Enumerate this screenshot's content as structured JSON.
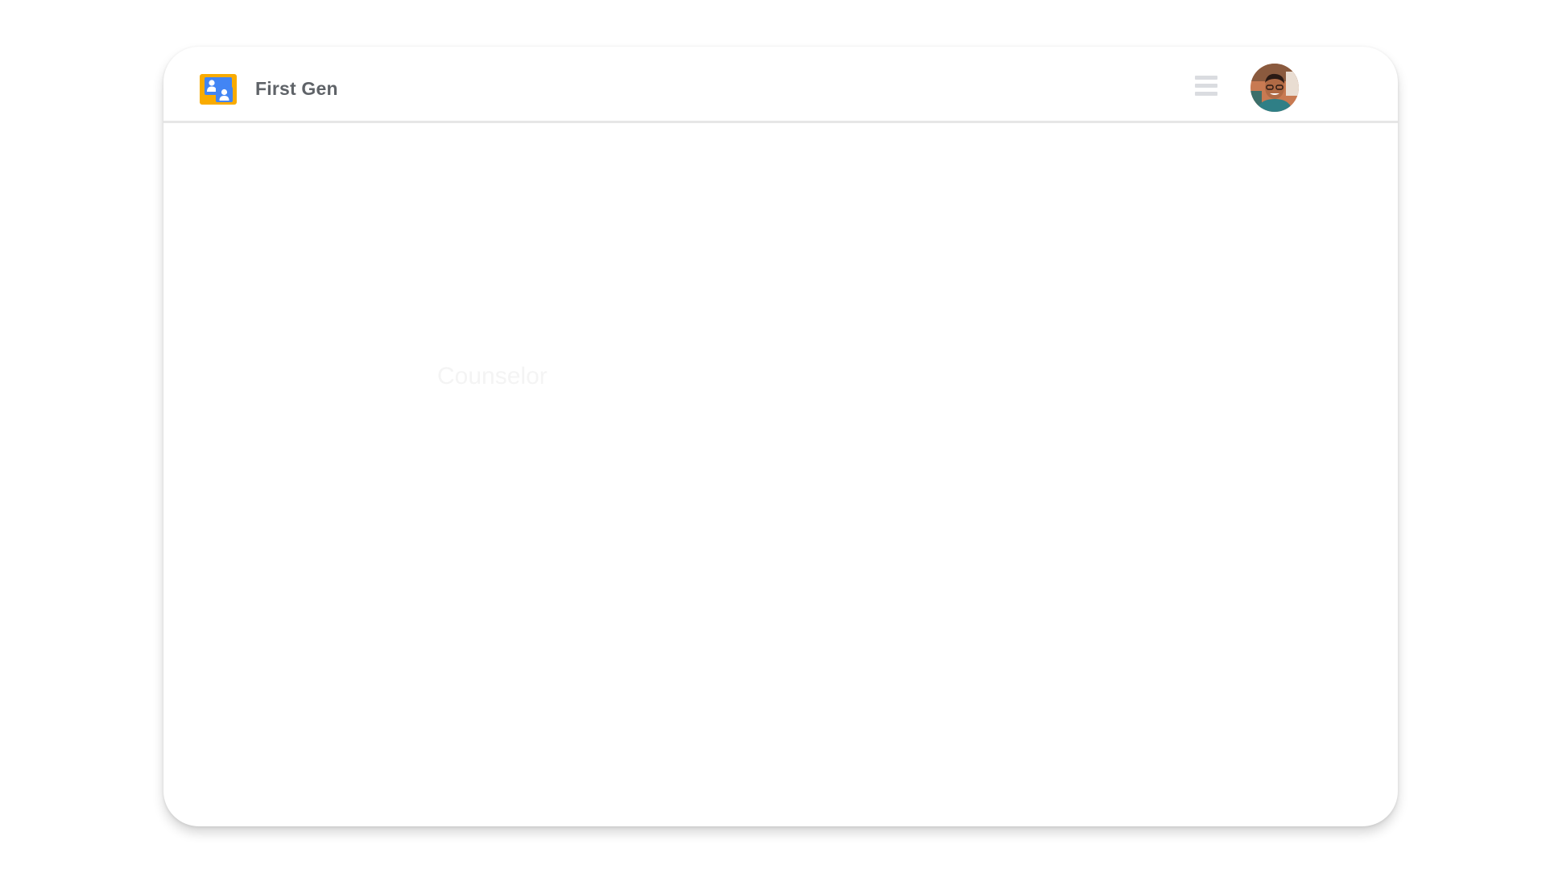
{
  "app": {
    "name": "First Gen"
  },
  "header": {
    "logo_icon": "people-card-icon",
    "menu_icon": "hamburger-menu-icon",
    "avatar_icon": "user-avatar",
    "colors": {
      "logo_background": "#f9ab00",
      "logo_panel": "#4285f4",
      "brand_text": "#5f6368",
      "menu_lines": "#dadce0",
      "divider": "#e6e6e6"
    }
  },
  "content": {
    "faded_label": "Counselor"
  }
}
